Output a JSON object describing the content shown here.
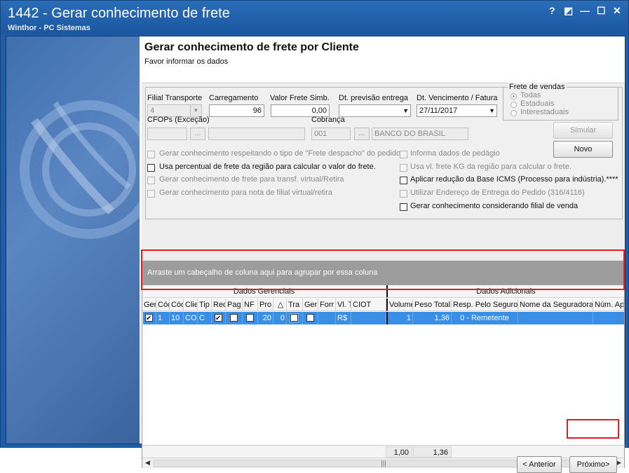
{
  "window": {
    "title": "1442 - Gerar conhecimento de frete",
    "subtitle": "Winthor - PC Sistemas",
    "controls": {
      "help": "?",
      "restore_alt": "◩",
      "minimize": "—",
      "maximize": "☐",
      "close": "✕"
    }
  },
  "header": {
    "title": "Gerar conhecimento de frete por Cliente",
    "subtitle": "Favor informar os dados"
  },
  "form": {
    "filial_label": "Filial Transporte",
    "filial_value": "4",
    "carregamento_label": "Carregamento",
    "carregamento_value": "96",
    "valor_frete_label": "Valor Frete Simb.",
    "valor_frete_value": "0,00",
    "dt_previsao_label": "Dt. previsão entrega",
    "dt_previsao_value": "",
    "dt_vencimento_label": "Dt. Vencimento / Fatura",
    "dt_vencimento_value": "27/11/2017",
    "frete_vendas_label": "Frete de vendas",
    "radio_todas": "Todas",
    "radio_estaduais": "Estaduais",
    "radio_interestaduais": "Interestaduais",
    "cfops_label": "CFOPs (Exceção)",
    "ellipsis": "...",
    "cobranca_label": "Cobrança",
    "cobranca_code": "001",
    "cobranca_name": "BANCO DO BRASIL",
    "simular_label": "Simular",
    "novo_label": "Novo"
  },
  "options_left": [
    {
      "label": "Gerar conhecimento respeitando o tipo de \"Frete despacho\" do pedido.",
      "enabled": false
    },
    {
      "label": "Usa percentual de frete da região para calcular o valor do frete.",
      "enabled": true
    },
    {
      "label": "Gerar conhecimento de frete para transf. virtual/Retira",
      "enabled": false
    },
    {
      "label": "Gerar conhecimento para nota de filial virtual/retira",
      "enabled": false
    }
  ],
  "options_right": [
    {
      "label": "Informa dados de pedágio",
      "enabled": false
    },
    {
      "label": "Usa vl. frete KG da região para calcular o frete.",
      "enabled": false
    },
    {
      "label": "Aplicar redução da Base ICMS (Processo para indústria).****",
      "enabled": true
    },
    {
      "label": "Utilizar Endereço de Entrega do Pedido (316/4116)",
      "enabled": false
    },
    {
      "label": "Gerar conhecimento considerando filial de venda",
      "enabled": true
    }
  ],
  "grid": {
    "group_hint": "Arraste um cabeçalho de coluna aqui para agrupar por essa coluna",
    "band_left": "Dados Gerenciais",
    "band_right": "Dados Adicionais",
    "columns": [
      "Ger",
      "Cód",
      "Cód",
      "Clie",
      "Tip",
      "Red",
      "Pag",
      "NF",
      "Pro",
      "△",
      "Tra",
      "Ger",
      "Forr",
      "Vl. T",
      "CIOT",
      "Volume",
      "Peso Total",
      "Resp. Pelo Seguro",
      "Nome da Seguradora",
      "Núm. Ap"
    ],
    "row": {
      "cod1": "1",
      "cod2": "10",
      "cli": "CO",
      "tip": "C",
      "pro": "20",
      "tri": "0",
      "vlt": "R$",
      "volume": "1",
      "peso_total": "1,36",
      "resp_seguro": "0 - Remetente"
    },
    "sum_volume": "1,00",
    "sum_peso": "1,36",
    "scroll_grip": "|||"
  },
  "nav": {
    "anterior": "< Anterior",
    "proximo": "Próximo>"
  }
}
